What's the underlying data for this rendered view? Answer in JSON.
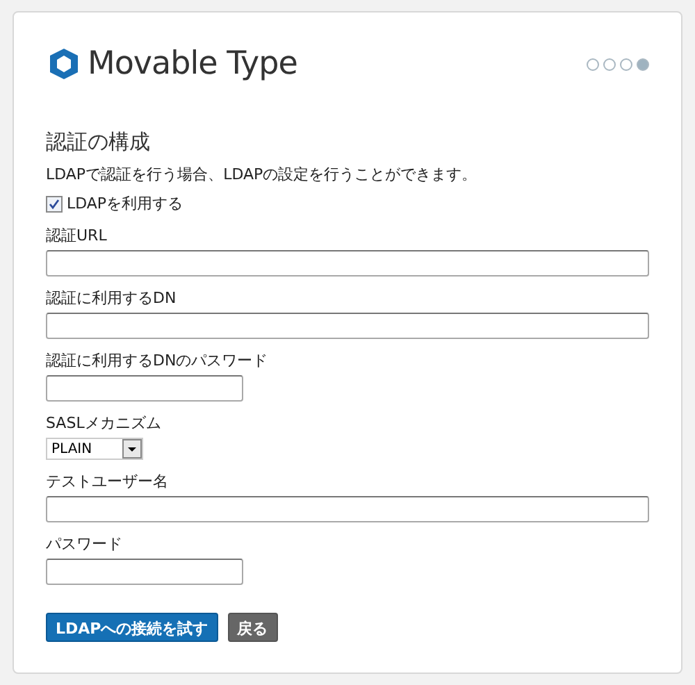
{
  "logo": {
    "text": "Movable Type"
  },
  "steps": [
    {
      "selected": false
    },
    {
      "selected": false
    },
    {
      "selected": false
    },
    {
      "selected": true
    }
  ],
  "heading": "認証の構成",
  "description": "LDAPで認証を行う場合、LDAPの設定を行うことができます。",
  "use_ldap": {
    "label": "LDAPを利用する",
    "checked": true
  },
  "fields": [
    {
      "kind": "wide",
      "label": "認証URL"
    },
    {
      "kind": "wide",
      "label": "認証に利用するDN"
    },
    {
      "kind": "short",
      "label": "認証に利用するDNのパスワード"
    },
    {
      "kind": "select",
      "label": "SASLメカニズム",
      "value": "PLAIN"
    },
    {
      "kind": "wide",
      "label": "テストユーザー名"
    },
    {
      "kind": "short",
      "label": "パスワード"
    }
  ],
  "buttons": [
    {
      "kind": "primary",
      "label": "LDAPへの接続を試す"
    },
    {
      "kind": "secondary",
      "label": "戻る"
    }
  ]
}
